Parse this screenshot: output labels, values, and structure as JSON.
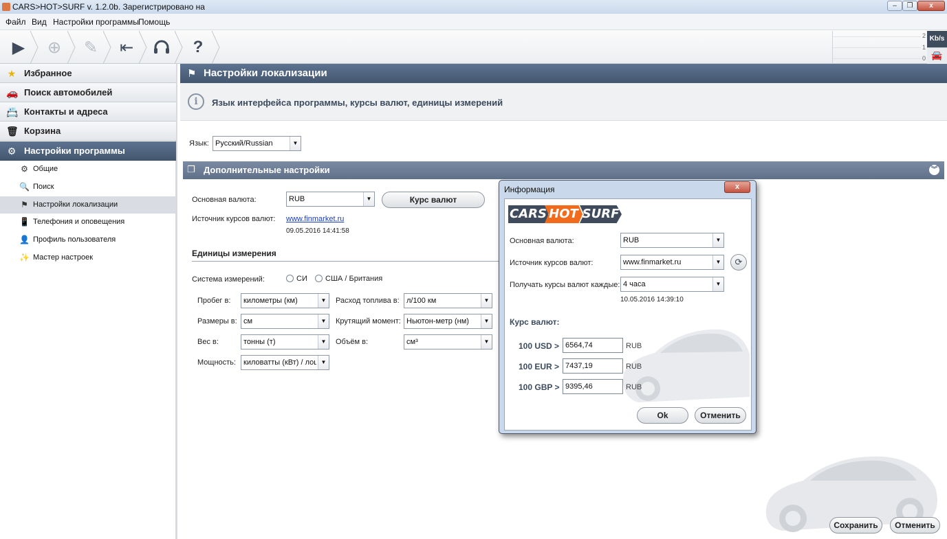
{
  "window": {
    "title": "CARS>HOT>SURF v. 1.2.0b. Зарегистрировано на"
  },
  "menu": [
    "Файл",
    "Вид",
    "Настройки программы",
    "Помощь"
  ],
  "toolbar_icons": [
    "play-icon",
    "add-icon",
    "edit-icon",
    "back-to-start-icon",
    "headset-icon",
    "help-icon"
  ],
  "toolbar_glyphs": {
    "play": "▶",
    "add": "⊕",
    "edit": "✎",
    "back": "⇤",
    "headset": "🎧",
    "help": "?"
  },
  "speed": {
    "ticks": [
      "2",
      "1",
      "0"
    ],
    "unit": "Kb/s"
  },
  "sidebar": {
    "sections": [
      {
        "label": "Избранное",
        "icon": "★"
      },
      {
        "label": "Поиск автомобилей",
        "icon": "🚗"
      },
      {
        "label": "Контакты и адреса",
        "icon": "📇"
      },
      {
        "label": "Корзина",
        "icon": "🗑"
      },
      {
        "label": "Настройки программы",
        "icon": "⚙"
      }
    ],
    "items": [
      {
        "label": "Общие",
        "icon": "⚙"
      },
      {
        "label": "Поиск",
        "icon": "🔍"
      },
      {
        "label": "Настройки локализации",
        "icon": "⚑"
      },
      {
        "label": "Телефония и оповещения",
        "icon": "📱"
      },
      {
        "label": "Профиль пользователя",
        "icon": "👤"
      },
      {
        "label": "Мастер настроек",
        "icon": "✨"
      }
    ]
  },
  "main": {
    "header": "Настройки локализации",
    "info": "Язык интерфейса программы, курсы валют, единицы измерений",
    "language_label": "Язык:",
    "language_value": "Русский/Russian",
    "additional_header": "Дополнительные настройки",
    "currency_label": "Основная валюта:",
    "currency_value": "RUB",
    "rates_button": "Курс валют",
    "source_label": "Источник курсов валют:",
    "source_link": "www.finmarket.ru",
    "source_date": "09.05.2016 14:41:58",
    "units_header": "Единицы измерения",
    "system_label": "Система измерений:",
    "system_si": "СИ",
    "system_us": "США / Британия",
    "mileage_label": "Пробег в:",
    "mileage_value": "километры (км)",
    "fuel_label": "Расход топлива в:",
    "fuel_value": "л/100 км",
    "size_label": "Размеры в:",
    "size_value": "см",
    "torque_label": "Крутящий момент:",
    "torque_value": "Ньютон-метр (нм)",
    "weight_label": "Вес в:",
    "weight_value": "тонны (т)",
    "volume_label": "Объём в:",
    "volume_value": "см³",
    "power_label": "Мощность:",
    "power_value": "киловатты (кВт) / лошадиные силы (л.с.)",
    "save_button": "Сохранить",
    "cancel_button": "Отменить"
  },
  "dialog": {
    "title": "Информация",
    "close": "x",
    "logo": [
      "CARS",
      "HOT",
      "SURF"
    ],
    "currency_label": "Основная валюта:",
    "currency_value": "RUB",
    "source_label": "Источник курсов валют:",
    "source_value": "www.finmarket.ru",
    "interval_label": "Получать курсы валют каждые:",
    "interval_value": "4 часа",
    "updated": "10.05.2016 14:39:10",
    "rates_header": "Курс валют:",
    "rates": [
      {
        "label": "100 USD >",
        "value": "6564,74",
        "unit": "RUB"
      },
      {
        "label": "100 EUR >",
        "value": "7437,19",
        "unit": "RUB"
      },
      {
        "label": "100 GBP >",
        "value": "9395,46",
        "unit": "RUB"
      }
    ],
    "ok": "Ok",
    "cancel": "Отменить"
  },
  "colors": {
    "header": "#4f6480",
    "logo_dark": "#3f4b5c",
    "logo_orange": "#f26b1d",
    "link": "#1a3cc4"
  }
}
